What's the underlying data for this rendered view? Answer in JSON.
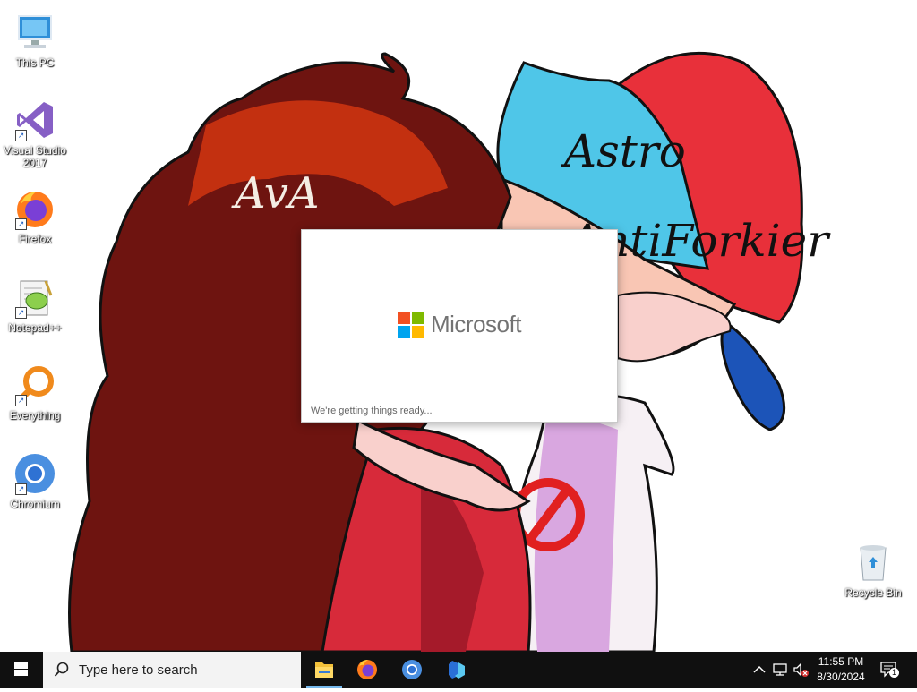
{
  "wallpaper": {
    "text_1": "AvA",
    "text_2": "Astro",
    "text_3": "AntiForkier"
  },
  "desktop_icons": [
    {
      "label": "This PC",
      "icon": "computer-icon",
      "shortcut": false
    },
    {
      "label": "Visual Studio 2017",
      "icon": "visual-studio-icon",
      "shortcut": true
    },
    {
      "label": "Firefox",
      "icon": "firefox-icon",
      "shortcut": true
    },
    {
      "label": "Notepad++",
      "icon": "notepad-plus-plus-icon",
      "shortcut": true
    },
    {
      "label": "Everything",
      "icon": "everything-search-icon",
      "shortcut": true
    },
    {
      "label": "Chromium",
      "icon": "chromium-icon",
      "shortcut": true
    },
    {
      "label": "Recycle Bin",
      "icon": "recycle-bin-icon",
      "shortcut": false
    }
  ],
  "splash": {
    "brand": "Microsoft",
    "status": "We're getting things ready...",
    "logo_colors": [
      "#f25022",
      "#7fba00",
      "#00a4ef",
      "#ffb900"
    ]
  },
  "taskbar": {
    "search_placeholder": "Type here to search",
    "apps": [
      {
        "name": "File Explorer",
        "icon": "file-explorer-icon",
        "active": true
      },
      {
        "name": "Firefox",
        "icon": "firefox-icon",
        "active": false
      },
      {
        "name": "Chromium",
        "icon": "chromium-icon",
        "active": false
      },
      {
        "name": "Copilot",
        "icon": "copilot-icon",
        "active": false
      }
    ],
    "tray": {
      "time": "11:55 PM",
      "date": "8/30/2024",
      "notification_count": "1",
      "icons": [
        "chevron-up-icon",
        "network-icon",
        "volume-muted-icon",
        "notification-icon"
      ]
    }
  },
  "colors": {
    "taskbar": "#101010",
    "search_box": "#f3f3f3",
    "accent": "#76b9ed"
  }
}
